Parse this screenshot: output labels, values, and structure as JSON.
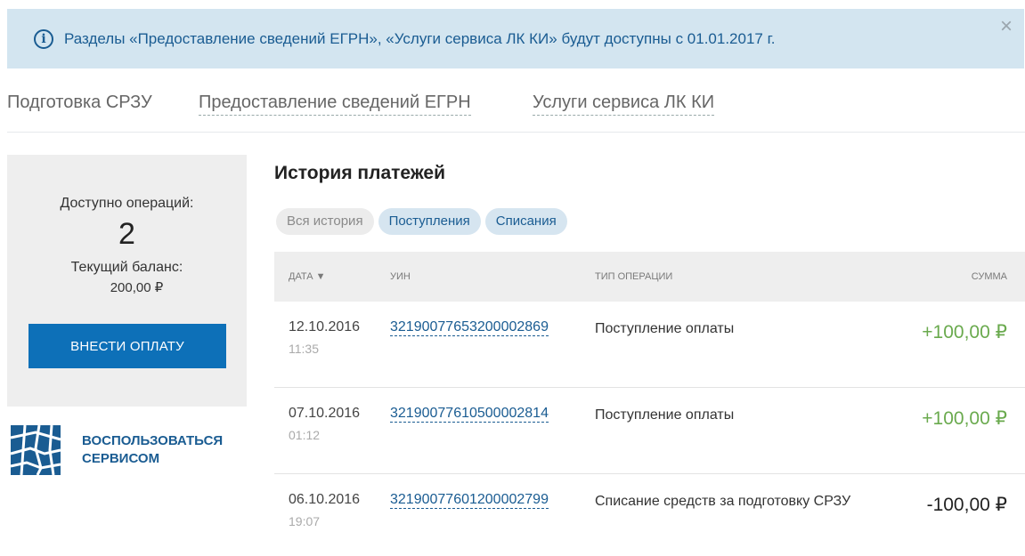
{
  "notice": {
    "icon": "info-icon",
    "text": "Разделы «Предоставление сведений ЕГРН», «Услуги сервиса ЛК КИ» будут доступны с 01.01.2017 г.",
    "close": "×"
  },
  "topnav": {
    "items": [
      "Подготовка СРЗУ",
      "Предоставление сведений ЕГРН",
      "Услуги сервиса ЛК КИ"
    ]
  },
  "sidebar": {
    "ops_label": "Доступно операций:",
    "ops_count": "2",
    "balance_label": "Текущий баланс:",
    "balance_value": "200,00 ₽",
    "pay_button": "ВНЕСТИ ОПЛАТУ",
    "service_link": [
      "ВОСПОЛЬЗОВАТЬСЯ",
      "СЕРВИСОМ"
    ]
  },
  "history": {
    "title": "История платежей",
    "filters": [
      "Вся история",
      "Поступления",
      "Списания"
    ],
    "columns": [
      "ДАТА ▼",
      "УИН",
      "ТИП ОПЕРАЦИИ",
      "СУММА"
    ],
    "rows": [
      {
        "date": "12.10.2016",
        "time": "11:35",
        "uin": "32190077653200002869",
        "type": "Поступление оплаты",
        "amount": "+100,00 ₽"
      },
      {
        "date": "07.10.2016",
        "time": "01:12",
        "uin": "32190077610500002814",
        "type": "Поступление оплаты",
        "amount": "+100,00 ₽"
      },
      {
        "date": "06.10.2016",
        "time": "19:07",
        "uin": "32190077601200002799",
        "type": "Списание средств за подготовку СРЗУ",
        "amount": "-100,00 ₽"
      }
    ]
  },
  "colors": {
    "accent": "#0d70b8",
    "link": "#1a5c92",
    "positive": "#6aaa4e",
    "notice_bg": "#d3e5f0"
  }
}
